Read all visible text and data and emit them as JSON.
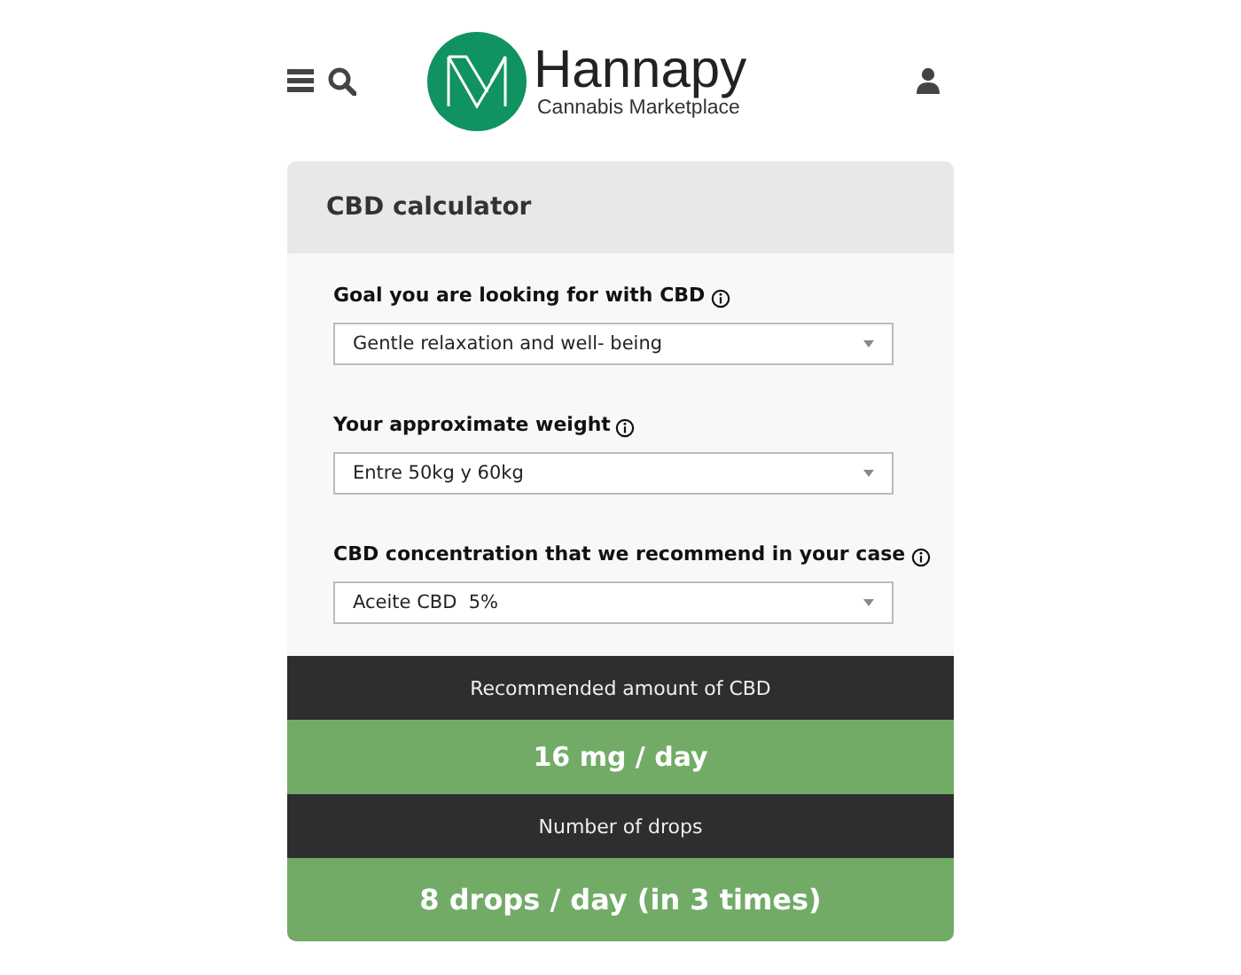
{
  "header": {
    "brand": "Hannapy",
    "tagline": "Cannabis Marketplace"
  },
  "calculator": {
    "title": "CBD calculator",
    "fields": [
      {
        "label": "Goal you are looking for with CBD",
        "value": "Gentle relaxation and well- being"
      },
      {
        "label": "Your approximate weight",
        "value": "Entre 50kg y 60kg"
      },
      {
        "label": "CBD concentration that we recommend in your case",
        "value": "Aceite CBD  5%"
      }
    ],
    "results": [
      {
        "heading": "Recommended amount of CBD",
        "value": "16 mg / day"
      },
      {
        "heading": "Number of drops",
        "value": "8 drops / day (in 3 times)"
      }
    ]
  }
}
